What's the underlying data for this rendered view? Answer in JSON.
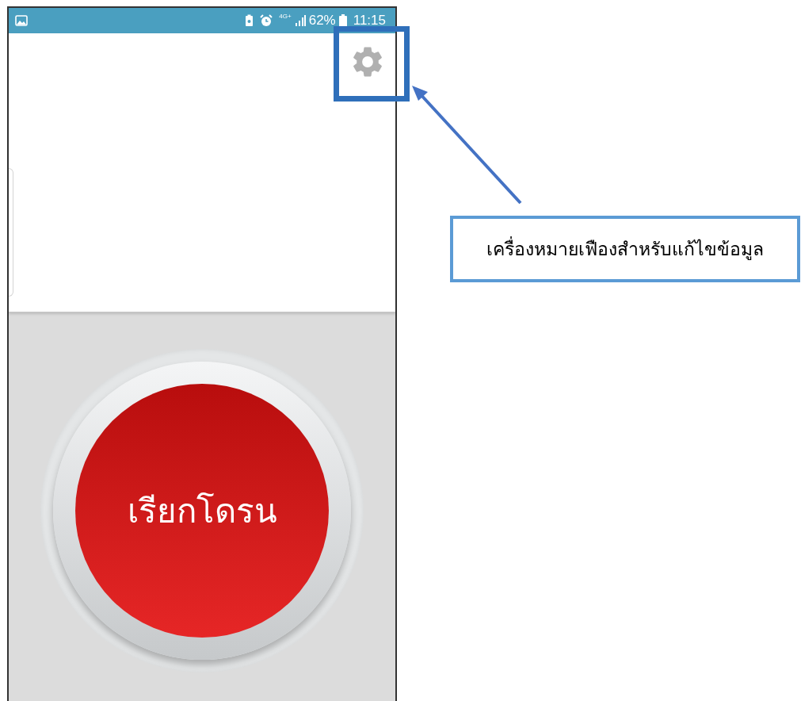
{
  "status_bar": {
    "network": "4G+",
    "battery": "62%",
    "time": "11:15"
  },
  "call_button": {
    "label": "เรียกโดรน"
  },
  "annotation": {
    "text": "เครื่องหมายเฟืองสำหรับแก้ไขข้อมูล"
  }
}
